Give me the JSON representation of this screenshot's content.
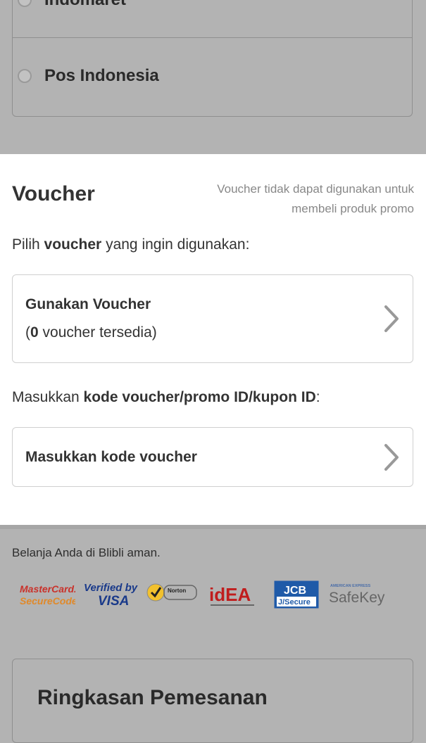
{
  "shipping": {
    "options": [
      {
        "label": "Indomaret"
      },
      {
        "label": "Pos Indonesia"
      }
    ]
  },
  "voucher": {
    "title": "Voucher",
    "note": "Voucher tidak dapat digunakan untuk membeli produk promo",
    "prompt_pre": "Pilih ",
    "prompt_bold": "voucher",
    "prompt_post": " yang ingin digunakan:",
    "use_card": {
      "title": "Gunakan Voucher",
      "sub_open": "(",
      "count": "0",
      "sub_rest": " voucher tersedia)"
    },
    "code_prompt_pre": "Masukkan ",
    "code_prompt_bold": "kode voucher/promo ID/kupon ID",
    "code_prompt_post": ":",
    "enter_card": {
      "title": "Masukkan kode voucher"
    }
  },
  "security": {
    "text": "Belanja Anda di Blibli aman.",
    "logos": {
      "mastercard_1": "MasterCard.",
      "mastercard_2": "SecureCode.",
      "visa_1": "Verified by",
      "visa_2": "VISA",
      "norton": "Norton",
      "idea": "idEA",
      "jcb_1": "JCB",
      "jcb_2": "J/Secure",
      "amex_1": "AMERICAN EXPRESS",
      "amex_2": "SafeKey"
    }
  },
  "summary": {
    "title": "Ringkasan Pemesanan"
  }
}
